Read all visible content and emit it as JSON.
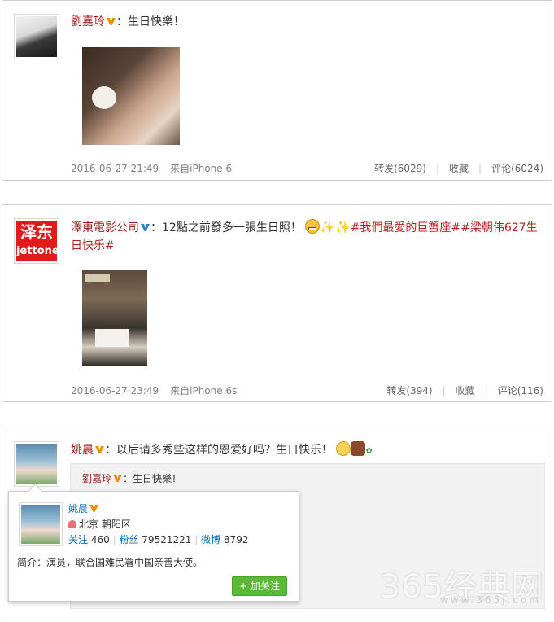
{
  "posts": [
    {
      "user": "劉嘉玲",
      "separator": "：",
      "text": "生日快樂！",
      "time": "2016-06-27 21:49",
      "source": "来自iPhone 6",
      "repost": "转发(6029)",
      "favorite": "收藏",
      "comment": "评论(6024)"
    },
    {
      "user": "澤東電影公司",
      "separator": "：",
      "text": "12點之前發多一張生日照！",
      "topic1": "#我們最愛的巨蟹座#",
      "topic2": "#梁朝伟627生日快乐#",
      "avatar_line1": "泽东",
      "avatar_line2": "jettone",
      "time": "2016-06-27 23:49",
      "source": "来自iPhone 6s",
      "repost": "转发(394)",
      "favorite": "收藏",
      "comment": "评论(116)"
    },
    {
      "user": "姚晨",
      "separator": "：",
      "text": "以后请多秀些这样的恩爱好吗？生日快乐！",
      "quoted_user": "劉嘉玲",
      "quoted_separator": "：",
      "quoted_text": "生日快樂！"
    }
  ],
  "profile_card": {
    "name": "姚晨",
    "location": "北京 朝阳区",
    "follow_label": "关注",
    "follow_count": "460",
    "fans_label": "粉丝",
    "fans_count": "79521221",
    "weibo_label": "微博",
    "weibo_count": "8792",
    "bio": "简介：演员，联合国难民署中国亲善大使。",
    "follow_button": "+ 加关注",
    "sep": "|"
  },
  "watermark": {
    "main": "365经典网",
    "sub": "www.365j.com"
  },
  "colors": {
    "username": "#9b1c1c",
    "link": "#0a6cb0",
    "follow_button": "#5bb936",
    "vip_badge": "#f08c00"
  }
}
